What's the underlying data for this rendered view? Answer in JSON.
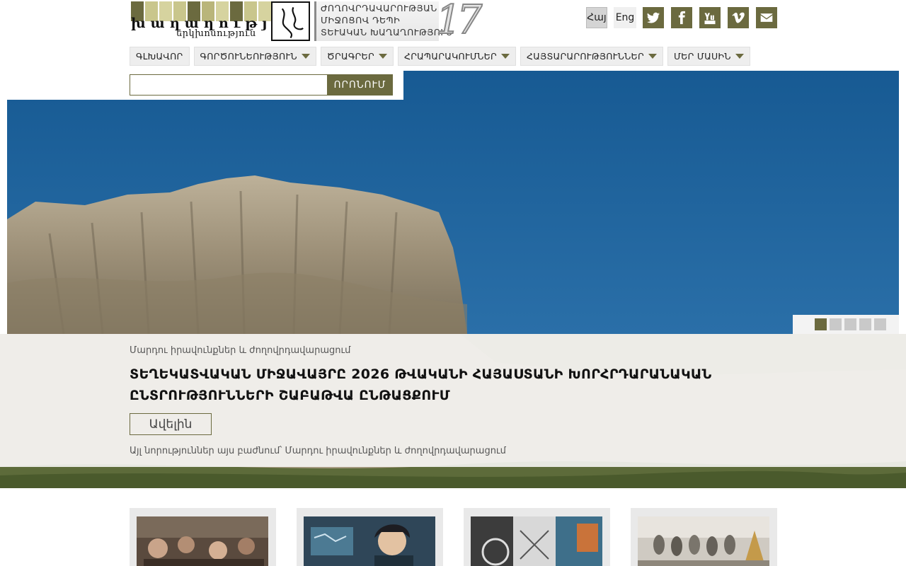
{
  "header": {
    "logo_word": "խաղաղության",
    "logo_sub": "երկխոսություն",
    "anniversary_lines": [
      "ԺՈՂՈՎՐԴԱՎԱՐՈՒԹՅԱՆ",
      "ՄԻՋՈՑՈՎ ԴԵՊԻ",
      "ՏԵՒԱԿԱՆ ԽԱՂԱՂՈՒԹՅՈՒՆ"
    ],
    "anniversary_number": "17",
    "lang_hy": "Հայ",
    "lang_en": "Eng",
    "social": [
      "twitter-icon",
      "facebook-icon",
      "youtube-icon",
      "vimeo-icon",
      "envelope-icon"
    ]
  },
  "nav": [
    {
      "label": "ԳԼԽԱՎՈՐ",
      "dropdown": false
    },
    {
      "label": "ԳՈՐԾՈՒՆԵՈՒԹՅՈՒՆ",
      "dropdown": true
    },
    {
      "label": "ԾՐԱԳՐԵՐ",
      "dropdown": true
    },
    {
      "label": "ՀՐԱՊԱՐԱԿՈՒՄՆԵՐ",
      "dropdown": true
    },
    {
      "label": "ՀԱՅՏԱՐԱՐՈՒԹՅՈՒՆՆԵՐ",
      "dropdown": true
    },
    {
      "label": "ՄԵՐ ՄԱՍԻՆ",
      "dropdown": true
    }
  ],
  "search": {
    "button": "ՈՐՈՆՈՒՄ",
    "value": ""
  },
  "slider": {
    "category": "Մարդու իրավունքներ և ժողովրդավարացում",
    "title": "ՏԵՂԵԿԱՏՎԱԿԱՆ ՄԻՋԱՎԱՅՐԸ 2026 ԹՎԱԿԱՆԻ ՀԱՅԱՍՏԱՆԻ ԽՈՐՀՐԴԱՐԱՆԱԿԱՆ ԸՆՏՐՈՒԹՅՈՒՆՆԵՐԻ ՇԱԲԱԹՎԱ ԸՆԹԱՑՔՈՒՄ",
    "more": "Ավելին",
    "other": "Այլ նորություններ այս բաժնում՝ Մարդու իրավունքներ և ժողովրդավարացում",
    "slide_count": 5,
    "active_slide": 1
  },
  "colors": {
    "accent": "#6b6a3f",
    "sky": "#1e5f95"
  }
}
